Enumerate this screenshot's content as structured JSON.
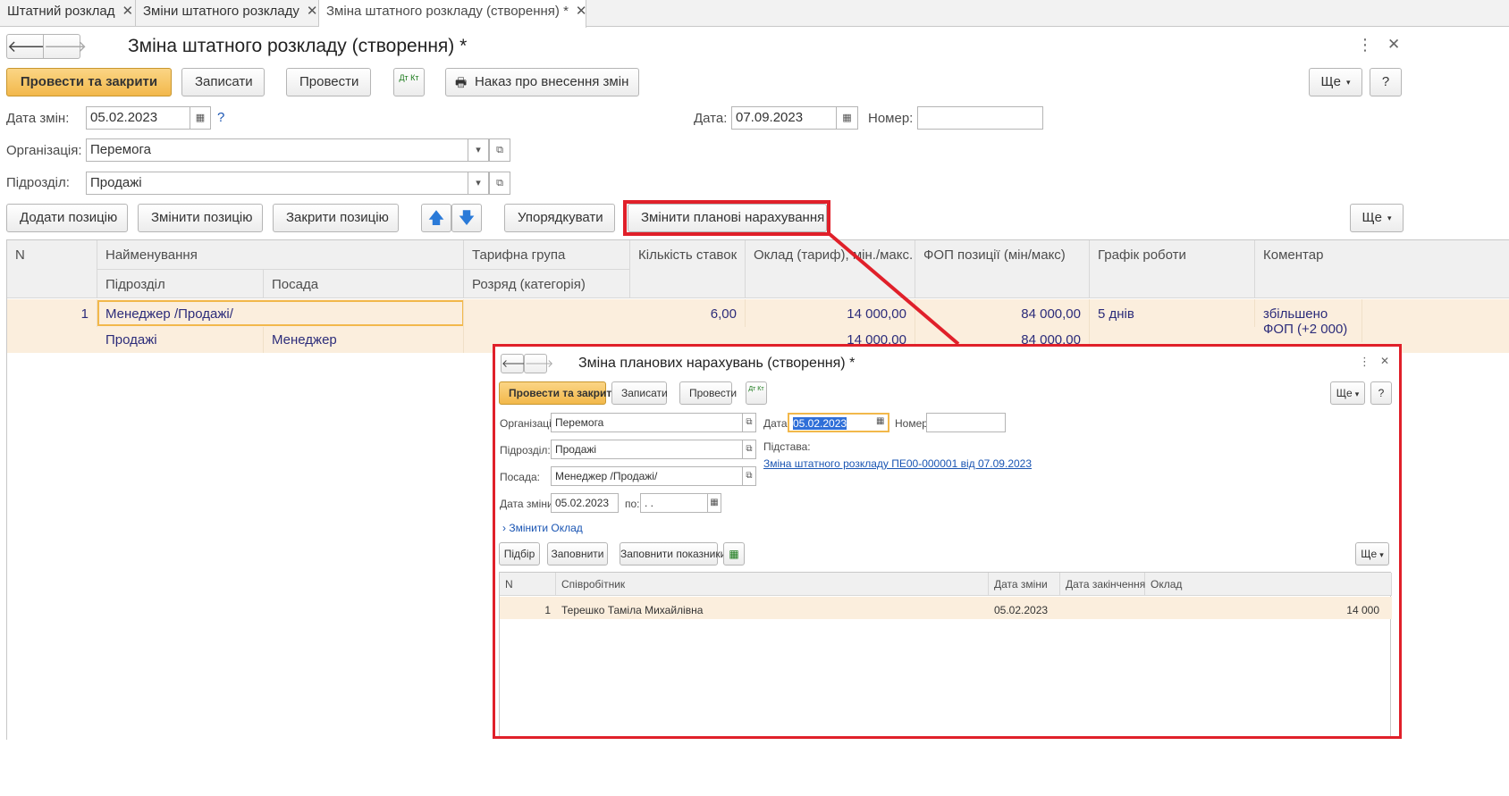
{
  "tabs": [
    {
      "label": "Штатний розклад",
      "close": "✕"
    },
    {
      "label": "Зміни штатного розкладу",
      "close": "✕"
    },
    {
      "label": "Зміна штатного розкладу (створення) *",
      "close": "✕"
    }
  ],
  "form": {
    "title": "Зміна штатного розкладу (створення) *",
    "toolbar": {
      "post_close": "Провести та закрити",
      "save": "Записати",
      "post": "Провести",
      "dtkt": "Дт Кт",
      "order": "Наказ про внесення змін",
      "more": "Ще",
      "help": "?"
    },
    "date_changes_label": "Дата змін:",
    "date_changes_value": "05.02.2023",
    "date_help": "?",
    "date_label": "Дата:",
    "date_value": "07.09.2023",
    "number_label": "Номер:",
    "number_value": "",
    "org_label": "Організація:",
    "org_value": "Перемога",
    "dept_label": "Підрозділ:",
    "dept_value": "Продажі",
    "table_toolbar": {
      "add": "Додати позицію",
      "change": "Змінити позицію",
      "close": "Закрити позицію",
      "sort": "Упорядкувати",
      "change_accruals": "Змінити планові нарахування",
      "more": "Ще"
    },
    "columns": {
      "n": "N",
      "name": "Найменування",
      "dept": "Підрозділ",
      "position": "Посада",
      "tariff": "Тарифна група",
      "grade": "Розряд (категорія)",
      "rates": "Кількість ставок",
      "salary": "Оклад (тариф), мін./макс.",
      "fop": "ФОП позиції (мін/макс)",
      "schedule": "Графік роботи",
      "comment": "Коментар"
    },
    "rows": [
      {
        "n": "1",
        "name": "Менеджер /Продажі/",
        "dept": "Продажі",
        "position": "Менеджер",
        "rates": "6,00",
        "salary": "14 000,00",
        "salary2": "14 000,00",
        "fop": "84 000,00",
        "fop2": "84 000,00",
        "schedule": "5 днів",
        "comment": "збільшено ФОП (+2 000)"
      }
    ]
  },
  "popup": {
    "title": "Зміна планових нарахувань (створення) *",
    "toolbar": {
      "post_close": "Провести та закрити",
      "save": "Записати",
      "post": "Провести",
      "dtkt": "Дт Кт",
      "more": "Ще",
      "help": "?"
    },
    "org_label": "Організація:",
    "org_value": "Перемога",
    "date_label": "Дата:",
    "date_value": "05.02.2023",
    "number_label": "Номер:",
    "number_value": "",
    "dept_label": "Підрозділ:",
    "dept_value": "Продажі",
    "basis_label": "Підстава:",
    "basis_link": "Зміна штатного розкладу ПЕ00-000001 від 07.09.2023",
    "position_label": "Посада:",
    "position_value": "Менеджер /Продажі/",
    "date_change_label": "Дата зміни:",
    "date_change_value": "05.02.2023",
    "to_label": "по:",
    "to_value": " .  .",
    "change_salary": "Змінити Оклад",
    "table_toolbar": {
      "pick": "Підбір",
      "fill": "Заповнити",
      "fill_indicators": "Заповнити показники",
      "more": "Ще"
    },
    "columns": {
      "n": "N",
      "employee": "Співробітник",
      "date_change": "Дата зміни",
      "date_end": "Дата закінчення",
      "salary": "Оклад"
    },
    "rows": [
      {
        "n": "1",
        "employee": "Терешко Таміла Михайлівна",
        "date_change": "05.02.2023",
        "date_end": "",
        "salary": "14 000"
      }
    ]
  },
  "colors": {
    "primary": "#f2b84b",
    "highlight": "#e0202a",
    "row_selected": "#fbeedd",
    "link": "#1a55b3"
  }
}
